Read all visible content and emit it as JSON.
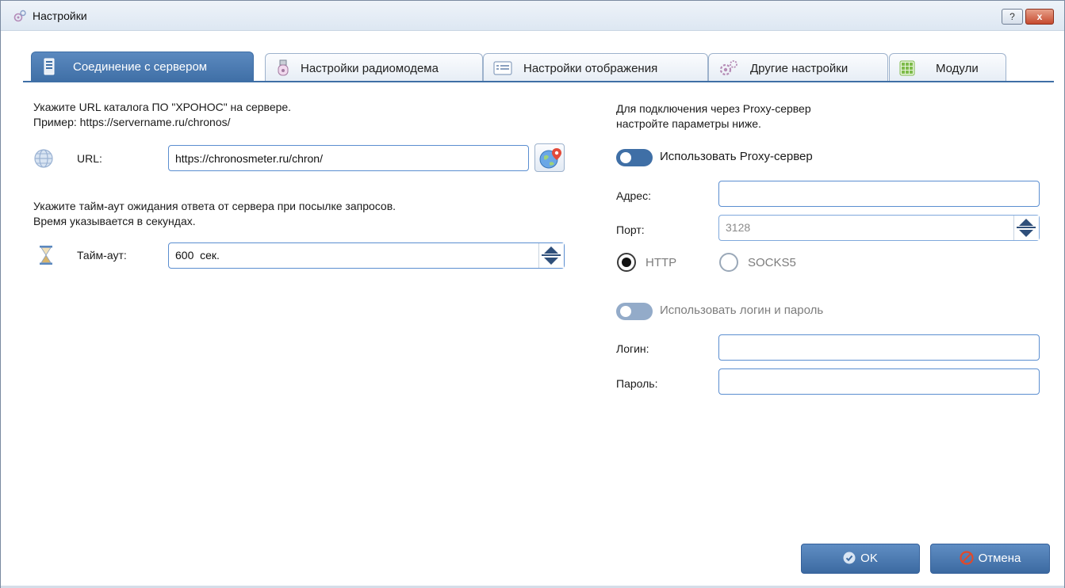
{
  "window": {
    "title": "Настройки"
  },
  "titlebar": {
    "help_label": "?",
    "close_label": "x"
  },
  "tabs": [
    {
      "label": "Соединение с сервером",
      "active": true
    },
    {
      "label": "Настройки радиомодема",
      "active": false
    },
    {
      "label": "Настройки отображения",
      "active": false
    },
    {
      "label": "Другие настройки",
      "active": false
    },
    {
      "label": "Модули",
      "active": false
    }
  ],
  "server": {
    "hint_line1": "Укажите URL каталога ПО \"ХРОНОС\" на сервере.",
    "hint_line2": "Пример: https://servername.ru/chronos/",
    "url_label": "URL:",
    "url_value": "https://chronosmeter.ru/chron/",
    "timeout_hint_line1": "Укажите тайм-аут ожидания ответа от сервера при посылке запросов.",
    "timeout_hint_line2": "Время указывается в секундах.",
    "timeout_label": "Тайм-аут:",
    "timeout_value": "600  сек."
  },
  "proxy": {
    "hint_line1": "Для подключения через Proxy-сервер",
    "hint_line2": "настройте параметры ниже.",
    "use_proxy_label": "Использовать Proxy-сервер",
    "address_label": "Адрес:",
    "address_value": "",
    "port_label": "Порт:",
    "port_value": "3128",
    "http_label": "HTTP",
    "socks5_label": "SOCKS5",
    "selected_protocol": "HTTP",
    "use_login_label": "Использовать логин и пароль",
    "login_label": "Логин:",
    "login_value": "",
    "password_label": "Пароль:",
    "password_value": ""
  },
  "buttons": {
    "ok_label": "OK",
    "cancel_label": "Отмена"
  },
  "colors": {
    "accent": "#3f6fa6",
    "field_border": "#5b8ed0",
    "text": "#1a1a1a",
    "cancel_icon": "#e0492a"
  }
}
